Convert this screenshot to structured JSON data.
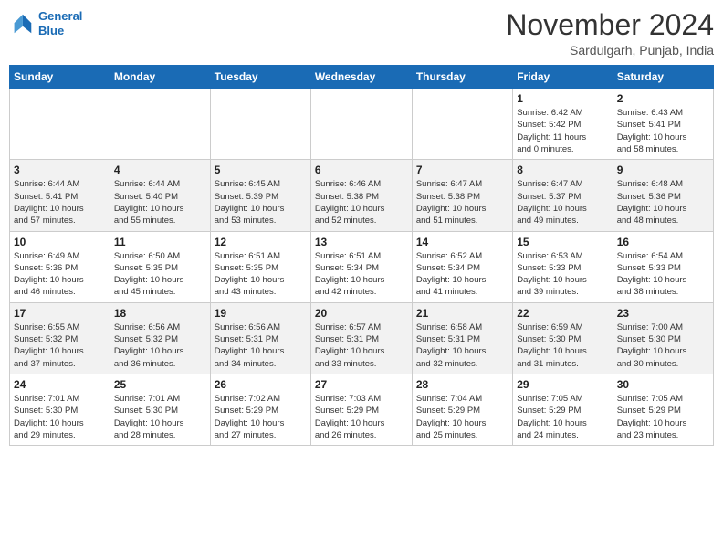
{
  "logo": {
    "line1": "General",
    "line2": "Blue"
  },
  "title": "November 2024",
  "location": "Sardulgarh, Punjab, India",
  "weekdays": [
    "Sunday",
    "Monday",
    "Tuesday",
    "Wednesday",
    "Thursday",
    "Friday",
    "Saturday"
  ],
  "weeks": [
    [
      {
        "day": "",
        "info": ""
      },
      {
        "day": "",
        "info": ""
      },
      {
        "day": "",
        "info": ""
      },
      {
        "day": "",
        "info": ""
      },
      {
        "day": "",
        "info": ""
      },
      {
        "day": "1",
        "info": "Sunrise: 6:42 AM\nSunset: 5:42 PM\nDaylight: 11 hours\nand 0 minutes."
      },
      {
        "day": "2",
        "info": "Sunrise: 6:43 AM\nSunset: 5:41 PM\nDaylight: 10 hours\nand 58 minutes."
      }
    ],
    [
      {
        "day": "3",
        "info": "Sunrise: 6:44 AM\nSunset: 5:41 PM\nDaylight: 10 hours\nand 57 minutes."
      },
      {
        "day": "4",
        "info": "Sunrise: 6:44 AM\nSunset: 5:40 PM\nDaylight: 10 hours\nand 55 minutes."
      },
      {
        "day": "5",
        "info": "Sunrise: 6:45 AM\nSunset: 5:39 PM\nDaylight: 10 hours\nand 53 minutes."
      },
      {
        "day": "6",
        "info": "Sunrise: 6:46 AM\nSunset: 5:38 PM\nDaylight: 10 hours\nand 52 minutes."
      },
      {
        "day": "7",
        "info": "Sunrise: 6:47 AM\nSunset: 5:38 PM\nDaylight: 10 hours\nand 51 minutes."
      },
      {
        "day": "8",
        "info": "Sunrise: 6:47 AM\nSunset: 5:37 PM\nDaylight: 10 hours\nand 49 minutes."
      },
      {
        "day": "9",
        "info": "Sunrise: 6:48 AM\nSunset: 5:36 PM\nDaylight: 10 hours\nand 48 minutes."
      }
    ],
    [
      {
        "day": "10",
        "info": "Sunrise: 6:49 AM\nSunset: 5:36 PM\nDaylight: 10 hours\nand 46 minutes."
      },
      {
        "day": "11",
        "info": "Sunrise: 6:50 AM\nSunset: 5:35 PM\nDaylight: 10 hours\nand 45 minutes."
      },
      {
        "day": "12",
        "info": "Sunrise: 6:51 AM\nSunset: 5:35 PM\nDaylight: 10 hours\nand 43 minutes."
      },
      {
        "day": "13",
        "info": "Sunrise: 6:51 AM\nSunset: 5:34 PM\nDaylight: 10 hours\nand 42 minutes."
      },
      {
        "day": "14",
        "info": "Sunrise: 6:52 AM\nSunset: 5:34 PM\nDaylight: 10 hours\nand 41 minutes."
      },
      {
        "day": "15",
        "info": "Sunrise: 6:53 AM\nSunset: 5:33 PM\nDaylight: 10 hours\nand 39 minutes."
      },
      {
        "day": "16",
        "info": "Sunrise: 6:54 AM\nSunset: 5:33 PM\nDaylight: 10 hours\nand 38 minutes."
      }
    ],
    [
      {
        "day": "17",
        "info": "Sunrise: 6:55 AM\nSunset: 5:32 PM\nDaylight: 10 hours\nand 37 minutes."
      },
      {
        "day": "18",
        "info": "Sunrise: 6:56 AM\nSunset: 5:32 PM\nDaylight: 10 hours\nand 36 minutes."
      },
      {
        "day": "19",
        "info": "Sunrise: 6:56 AM\nSunset: 5:31 PM\nDaylight: 10 hours\nand 34 minutes."
      },
      {
        "day": "20",
        "info": "Sunrise: 6:57 AM\nSunset: 5:31 PM\nDaylight: 10 hours\nand 33 minutes."
      },
      {
        "day": "21",
        "info": "Sunrise: 6:58 AM\nSunset: 5:31 PM\nDaylight: 10 hours\nand 32 minutes."
      },
      {
        "day": "22",
        "info": "Sunrise: 6:59 AM\nSunset: 5:30 PM\nDaylight: 10 hours\nand 31 minutes."
      },
      {
        "day": "23",
        "info": "Sunrise: 7:00 AM\nSunset: 5:30 PM\nDaylight: 10 hours\nand 30 minutes."
      }
    ],
    [
      {
        "day": "24",
        "info": "Sunrise: 7:01 AM\nSunset: 5:30 PM\nDaylight: 10 hours\nand 29 minutes."
      },
      {
        "day": "25",
        "info": "Sunrise: 7:01 AM\nSunset: 5:30 PM\nDaylight: 10 hours\nand 28 minutes."
      },
      {
        "day": "26",
        "info": "Sunrise: 7:02 AM\nSunset: 5:29 PM\nDaylight: 10 hours\nand 27 minutes."
      },
      {
        "day": "27",
        "info": "Sunrise: 7:03 AM\nSunset: 5:29 PM\nDaylight: 10 hours\nand 26 minutes."
      },
      {
        "day": "28",
        "info": "Sunrise: 7:04 AM\nSunset: 5:29 PM\nDaylight: 10 hours\nand 25 minutes."
      },
      {
        "day": "29",
        "info": "Sunrise: 7:05 AM\nSunset: 5:29 PM\nDaylight: 10 hours\nand 24 minutes."
      },
      {
        "day": "30",
        "info": "Sunrise: 7:05 AM\nSunset: 5:29 PM\nDaylight: 10 hours\nand 23 minutes."
      }
    ]
  ]
}
